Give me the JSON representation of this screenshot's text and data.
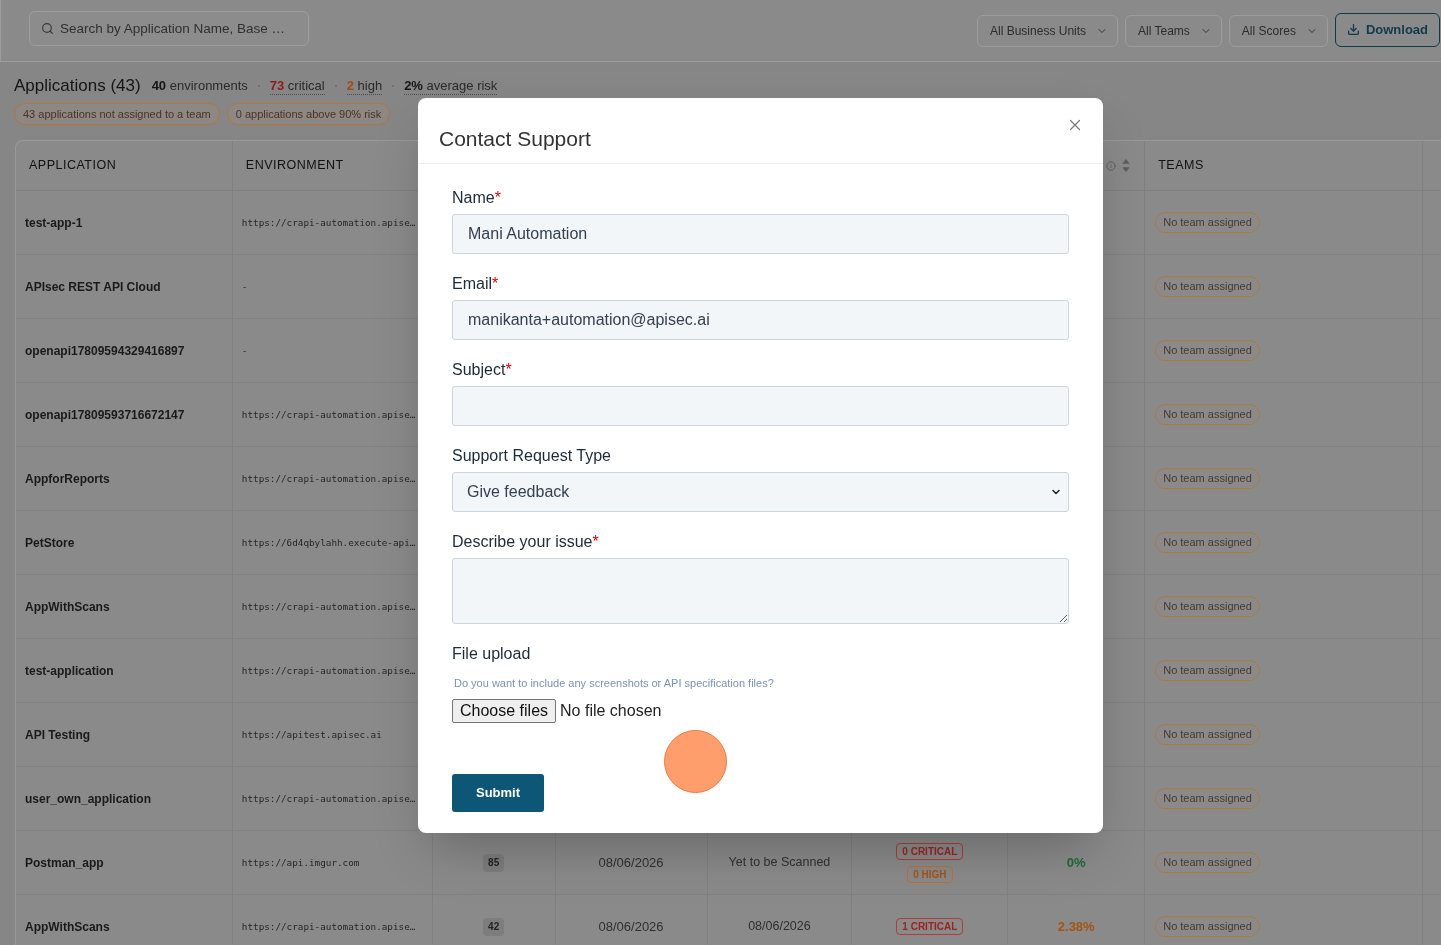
{
  "search": {
    "placeholder": "Search by Application Name, Base …"
  },
  "filters": [
    {
      "label": "All Business Units"
    },
    {
      "label": "All Teams"
    },
    {
      "label": "All Scores"
    }
  ],
  "download_button": "Download",
  "summary": {
    "title": "Applications (43)",
    "stats": [
      {
        "kind": "count",
        "number": "40",
        "text": "environments"
      },
      {
        "kind": "critical",
        "number": "73",
        "text": "critical"
      },
      {
        "kind": "high",
        "number": "2",
        "text": "high"
      },
      {
        "kind": "risk",
        "number": "2%",
        "text": "average risk"
      }
    ],
    "pills": [
      "43 applications not assigned to a team",
      "0 applications above 90% risk"
    ]
  },
  "table": {
    "headers": {
      "application": "APPLICATION",
      "environment": "ENVIRONMENT",
      "teams": "TEAMS"
    },
    "rows": [
      {
        "application": "test-app-1",
        "environment": "https://crapi-automation.apise…",
        "team": "No team assigned"
      },
      {
        "application": "APIsec REST API Cloud",
        "environment": "-",
        "team": "No team assigned"
      },
      {
        "application": "openapi17809594329416897",
        "environment": "-",
        "team": "No team assigned"
      },
      {
        "application": "openapi17809593716672147",
        "environment": "https://crapi-automation.apise…",
        "team": "No team assigned"
      },
      {
        "application": "AppforReports",
        "environment": "https://crapi-automation.apise…",
        "team": "No team assigned"
      },
      {
        "application": "PetStore",
        "environment": "https://6d4qbylahh.execute-api…",
        "team": "No team assigned"
      },
      {
        "application": "AppWithScans",
        "environment": "https://crapi-automation.apise…",
        "team": "No team assigned"
      },
      {
        "application": "test-application",
        "environment": "https://crapi-automation.apise…",
        "team": "No team assigned"
      },
      {
        "application": "API Testing",
        "environment": "https://apitest.apisec.ai",
        "team": "No team assigned"
      },
      {
        "application": "user_own_application",
        "environment": "https://crapi-automation.apise…",
        "team": "No team assigned"
      },
      {
        "application": "Postman_app",
        "environment": "https://api.imgur.com",
        "column_3": "85",
        "column_4": "08/06/2026",
        "column_5": "Yet to be Scanned",
        "column_6": [
          {
            "kind": "critical",
            "label": "0 CRITICAL"
          },
          {
            "kind": "high",
            "label": "0 HIGH"
          }
        ],
        "column_7": {
          "kind": "low",
          "text": "0%"
        },
        "team": "No team assigned"
      },
      {
        "application": "AppWithScans",
        "environment": "https://crapi-automation.apise…",
        "column_3": "42",
        "column_4": "08/06/2026",
        "column_5": "08/06/2026",
        "column_6": [
          {
            "kind": "critical",
            "label": "1 CRITICAL"
          }
        ],
        "column_7": {
          "kind": "medium",
          "text": "2.38%"
        },
        "team": "No team assigned"
      }
    ]
  },
  "dialog": {
    "title": "Contact Support",
    "fields": [
      {
        "kind": "text",
        "label": "Name",
        "mark": "*",
        "value": "Mani Automation"
      },
      {
        "kind": "text",
        "label": "Email",
        "mark": "*",
        "value": "manikanta+automation@apisec.ai"
      },
      {
        "kind": "text",
        "label": "Subject",
        "mark": "*"
      },
      {
        "kind": "select",
        "label": "Support Request Type",
        "value": "Give feedback"
      },
      {
        "kind": "textarea",
        "label": "Describe your issue",
        "mark": "*"
      },
      {
        "kind": "file",
        "label": "File upload",
        "hint": "Do you want to include any screenshots or API specification files?",
        "button": "Choose files",
        "status": "No file chosen"
      }
    ],
    "submit": "Submit"
  }
}
